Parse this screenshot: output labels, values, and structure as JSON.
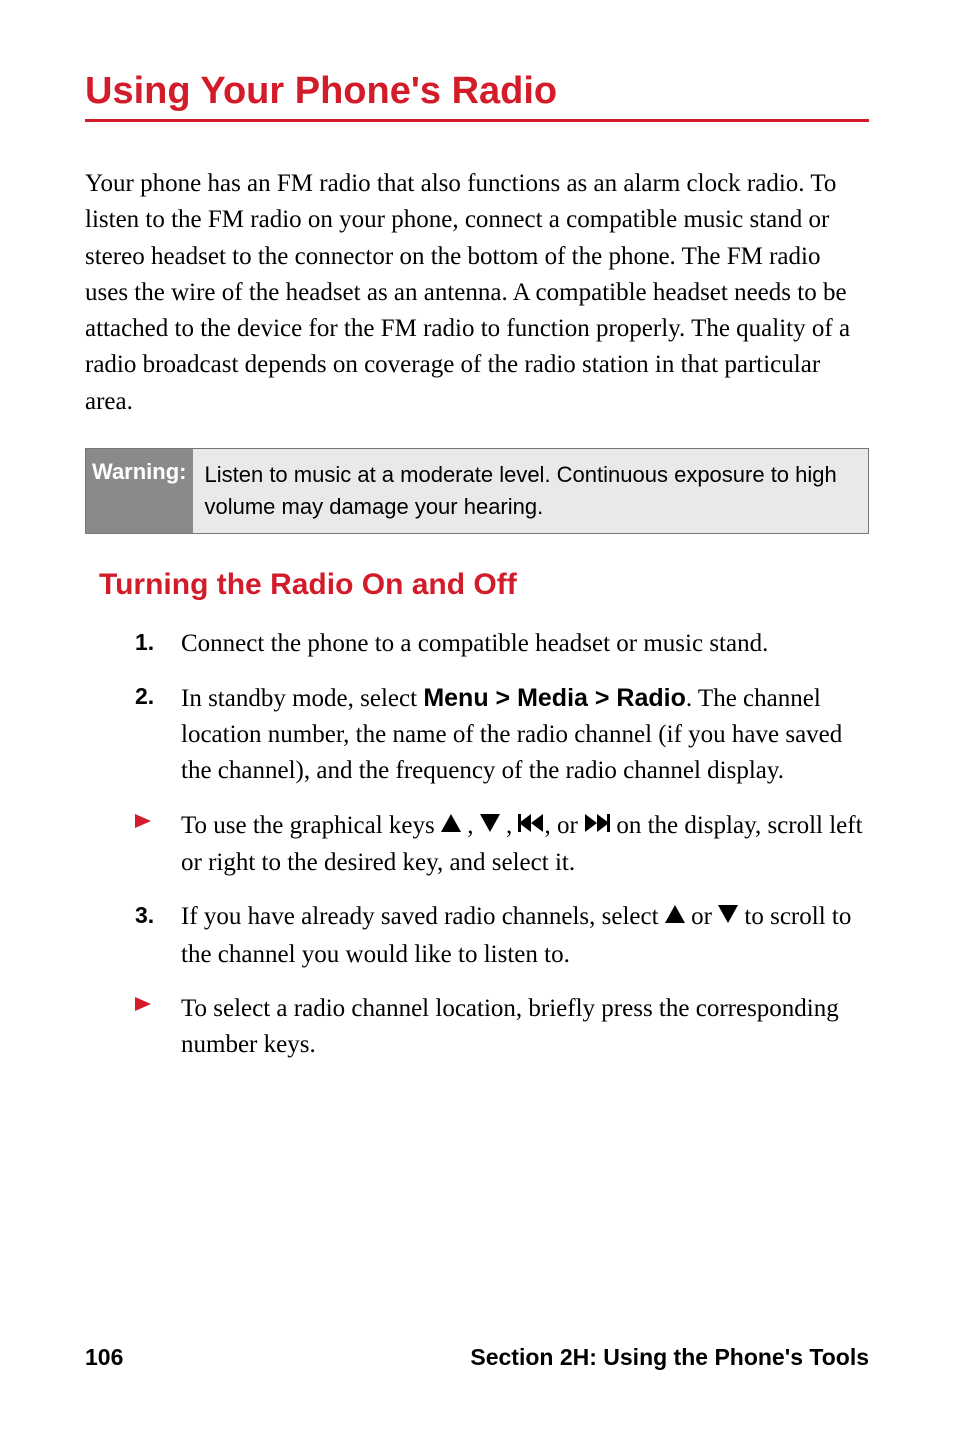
{
  "heading": "Using Your Phone's Radio",
  "intro": "Your phone has an FM radio that also functions as an alarm clock radio. To listen to the FM radio on your phone, connect a compatible music stand or stereo headset to the connector on the bottom of the phone. The FM radio uses the wire of the headset as an antenna. A compatible headset needs to be attached to the device for the FM radio to function properly. The quality of a radio broadcast depends on coverage of the radio station in that particular area.",
  "warning": {
    "label": "Warning:",
    "text": "Listen to music at a moderate level. Continuous exposure to high volume may damage your hearing."
  },
  "subheading": "Turning the Radio On and Off",
  "items": {
    "n1": "1.",
    "t1": "Connect the phone to a compatible headset or music stand.",
    "n2": "2.",
    "t2a": "In standby mode, select ",
    "t2b": "Menu > Media > Radio",
    "t2c": ". The channel location number, the name of the radio channel (if you have saved the channel), and the frequency of the radio channel display.",
    "t3a": "To use the graphical keys ",
    "t3b": " , ",
    "t3c": " , ",
    "t3d": ", or ",
    "t3e": " on the display, scroll left or right to the desired key, and select it.",
    "n3": "3.",
    "t4a": "If you have already saved radio channels, select ",
    "t4b": " or ",
    "t4c": " to scroll to the channel you would like to listen to.",
    "t5": "To select a radio channel location, briefly press the corresponding number keys."
  },
  "footer": {
    "page": "106",
    "section": "Section 2H: Using the Phone's Tools"
  }
}
